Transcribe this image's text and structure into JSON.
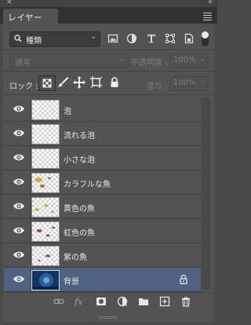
{
  "window": {
    "collapse_glyph": "«",
    "close_glyph": "×"
  },
  "tab": {
    "label": "レイヤー"
  },
  "filter": {
    "kind_label": "種類",
    "icons": [
      "pixel-layer-filter-icon",
      "adjustment-layer-filter-icon",
      "type-layer-filter-icon",
      "shape-layer-filter-icon",
      "smart-object-filter-icon"
    ]
  },
  "blend": {
    "mode": "通常"
  },
  "opacity": {
    "label": "不透明度 :",
    "value": "100%"
  },
  "lock": {
    "label": "ロック :"
  },
  "fill": {
    "label": "塗り :",
    "value": "100%"
  },
  "layers": [
    {
      "name": "泡",
      "visible": true,
      "selected": false,
      "locked": false
    },
    {
      "name": "流れる泡",
      "visible": true,
      "selected": false,
      "locked": false
    },
    {
      "name": "小さな泡",
      "visible": true,
      "selected": false,
      "locked": false
    },
    {
      "name": "カラフルな魚",
      "visible": true,
      "selected": false,
      "locked": false
    },
    {
      "name": "黄色の魚",
      "visible": true,
      "selected": false,
      "locked": false
    },
    {
      "name": "虹色の魚",
      "visible": true,
      "selected": false,
      "locked": false
    },
    {
      "name": "紫の魚",
      "visible": true,
      "selected": false,
      "locked": false
    },
    {
      "name": "背景",
      "visible": true,
      "selected": true,
      "locked": true
    }
  ],
  "colors": {
    "panel": "#535353",
    "selected_row": "#4f6281",
    "text": "#e8e8e8",
    "dim_text": "#7d7d7d"
  }
}
